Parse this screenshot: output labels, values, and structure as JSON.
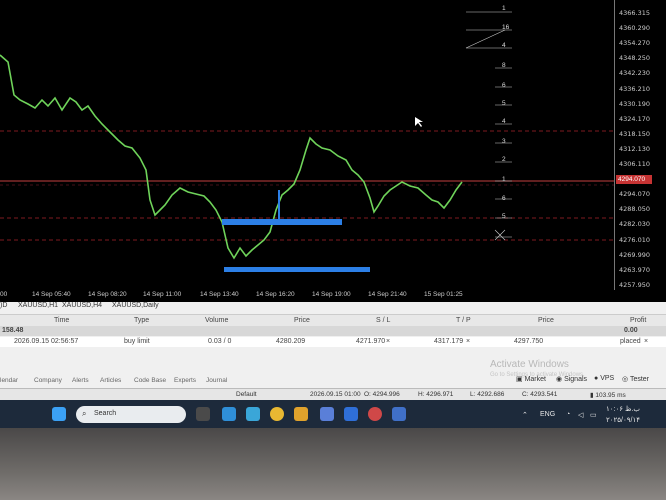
{
  "chart": {
    "price_ticks": [
      "4366.315",
      "4360.290",
      "4354.270",
      "4348.250",
      "4342.230",
      "4336.210",
      "4330.190",
      "4324.170",
      "4318.150",
      "4312.130",
      "4306.110",
      "4300.090",
      "4294.070",
      "4288.050",
      "4282.030",
      "4276.010",
      "4269.990",
      "4263.970",
      "4257.950"
    ],
    "current_price": "4294.070",
    "time_ticks": [
      "00",
      "14 Sep 05:40",
      "14 Sep 08:20",
      "14 Sep 11:00",
      "14 Sep 13:40",
      "14 Sep 16:20",
      "14 Sep 19:00",
      "14 Sep 21:40",
      "15 Sep 01:25"
    ],
    "level_labels": [
      "1",
      "16",
      "4",
      "8",
      "6",
      "5",
      "4",
      "3",
      "2",
      "1",
      "6",
      "5"
    ],
    "colors": {
      "price_line": "#6fd35a",
      "level_line": "#a8232b",
      "order_box": "#2c7fe6",
      "background": "#000000"
    }
  },
  "terminal": {
    "symbol_tabs": [
      "XAUUSD,H1",
      "XAUUSD,H4",
      "XAUUSD,Daily"
    ],
    "columns": [
      "Time",
      "Type",
      "Volume",
      "Price",
      "S / L",
      "T / P",
      "Price",
      "Profit"
    ],
    "balance_label": "158.48",
    "balance_profit": "0.00",
    "order": {
      "time": "2026.09.15 02:56:57",
      "type": "buy limit",
      "volume": "0.03 / 0",
      "price": "4280.209",
      "sl": "4271.970",
      "tp": "4317.179",
      "current_price": "4297.750",
      "profit": "placed"
    },
    "bottom_tabs": [
      "lendar",
      "Company",
      "Alerts",
      "Articles",
      "Code Base",
      "Experts",
      "Journal"
    ],
    "toolbar": {
      "market": "Market",
      "signals": "Signals",
      "vps": "VPS",
      "tester": "Tester"
    },
    "watermark_title": "Activate Windows",
    "watermark_sub": "Go to Settings to activate Windows.",
    "status": {
      "profile": "Default",
      "datetime": "2026.09.15 01:00",
      "open": "O: 4294.996",
      "high": "H: 4296.971",
      "low": "L: 4292.686",
      "close": "C: 4293.541",
      "ping": "103.95 ms"
    }
  },
  "taskbar": {
    "search_placeholder": "Search",
    "lang": "ENG",
    "time": "۱۰:۰۶ ب.ظ",
    "date": "۲۰۲۵/۰۹/۱۴"
  }
}
